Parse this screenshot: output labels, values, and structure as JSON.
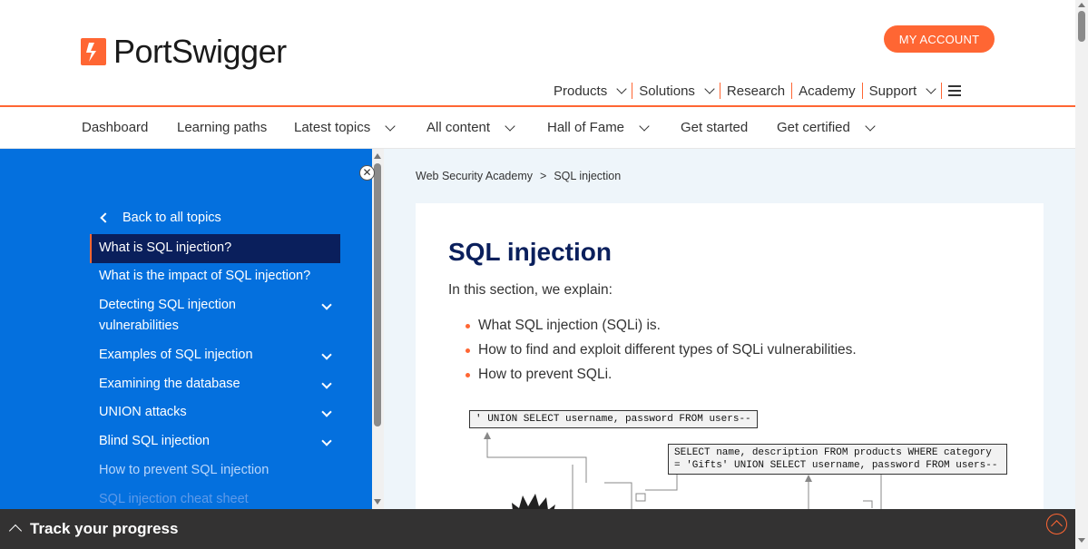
{
  "header": {
    "logo_text": "PortSwigger",
    "account_button": "MY ACCOUNT",
    "nav": [
      {
        "label": "Products",
        "dropdown": true
      },
      {
        "label": "Solutions",
        "dropdown": true
      },
      {
        "label": "Research",
        "dropdown": false
      },
      {
        "label": "Academy",
        "dropdown": false
      },
      {
        "label": "Support",
        "dropdown": true
      }
    ],
    "menu_icon": "hamburger-icon"
  },
  "subnav": [
    {
      "label": "Dashboard",
      "dropdown": false
    },
    {
      "label": "Learning paths",
      "dropdown": false
    },
    {
      "label": "Latest topics",
      "dropdown": true
    },
    {
      "label": "All content",
      "dropdown": true
    },
    {
      "label": "Hall of Fame",
      "dropdown": true
    },
    {
      "label": "Get started",
      "dropdown": false
    },
    {
      "label": "Get certified",
      "dropdown": true
    }
  ],
  "sidebar": {
    "close_icon": "close-icon",
    "back_label": "Back to all topics",
    "items": [
      {
        "label": "What is SQL injection?",
        "active": true,
        "expandable": false
      },
      {
        "label": "What is the impact of SQL injection?",
        "active": false,
        "expandable": false
      },
      {
        "label": "Detecting SQL injection vulnerabilities",
        "active": false,
        "expandable": true
      },
      {
        "label": "Examples of SQL injection",
        "active": false,
        "expandable": true
      },
      {
        "label": "Examining the database",
        "active": false,
        "expandable": true
      },
      {
        "label": "UNION attacks",
        "active": false,
        "expandable": true
      },
      {
        "label": "Blind SQL injection",
        "active": false,
        "expandable": true
      },
      {
        "label": "How to prevent SQL injection",
        "active": false,
        "expandable": false
      },
      {
        "label": "SQL injection cheat sheet",
        "active": false,
        "expandable": false
      }
    ]
  },
  "main": {
    "breadcrumb": [
      "Web Security Academy",
      "SQL injection"
    ],
    "breadcrumb_sep": ">",
    "title": "SQL injection",
    "intro": "In this section, we explain:",
    "points": [
      "What SQL injection (SQLi) is.",
      "How to find and exploit different types of SQLi vulnerabilities.",
      "How to prevent SQLi."
    ],
    "diagram": {
      "payload": "' UNION SELECT username, password FROM users--",
      "query_line1": "SELECT name, description FROM products WHERE category",
      "query_line2": "= 'Gifts' UNION SELECT username, password FROM users--"
    }
  },
  "footer": {
    "progress_label": "Track your progress"
  },
  "colors": {
    "brand_orange": "#ff6633",
    "sidebar_blue": "#0470de",
    "active_navy": "#0a1f5c",
    "footer_dark": "#333232"
  }
}
